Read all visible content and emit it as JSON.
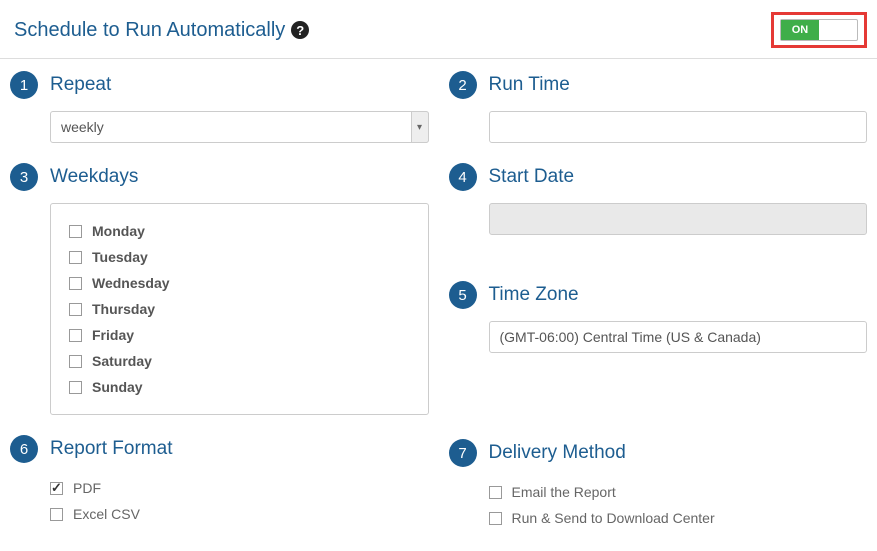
{
  "header": {
    "title": "Schedule to Run Automatically",
    "toggle_label": "ON"
  },
  "steps": {
    "repeat": {
      "num": "1",
      "title": "Repeat",
      "value": "weekly"
    },
    "runtime": {
      "num": "2",
      "title": "Run Time",
      "value": ""
    },
    "weekdays": {
      "num": "3",
      "title": "Weekdays",
      "items": [
        {
          "label": "Monday",
          "checked": false
        },
        {
          "label": "Tuesday",
          "checked": false
        },
        {
          "label": "Wednesday",
          "checked": false
        },
        {
          "label": "Thursday",
          "checked": false
        },
        {
          "label": "Friday",
          "checked": false
        },
        {
          "label": "Saturday",
          "checked": false
        },
        {
          "label": "Sunday",
          "checked": false
        }
      ]
    },
    "startdate": {
      "num": "4",
      "title": "Start Date",
      "value": ""
    },
    "timezone": {
      "num": "5",
      "title": "Time Zone",
      "value": "(GMT-06:00) Central Time (US & Canada)"
    },
    "format": {
      "num": "6",
      "title": "Report Format",
      "items": [
        {
          "label": "PDF",
          "checked": true
        },
        {
          "label": "Excel CSV",
          "checked": false
        }
      ]
    },
    "delivery": {
      "num": "7",
      "title": "Delivery Method",
      "items": [
        {
          "label": "Email the Report",
          "checked": false
        },
        {
          "label": "Run & Send to Download Center",
          "checked": false
        }
      ]
    }
  }
}
